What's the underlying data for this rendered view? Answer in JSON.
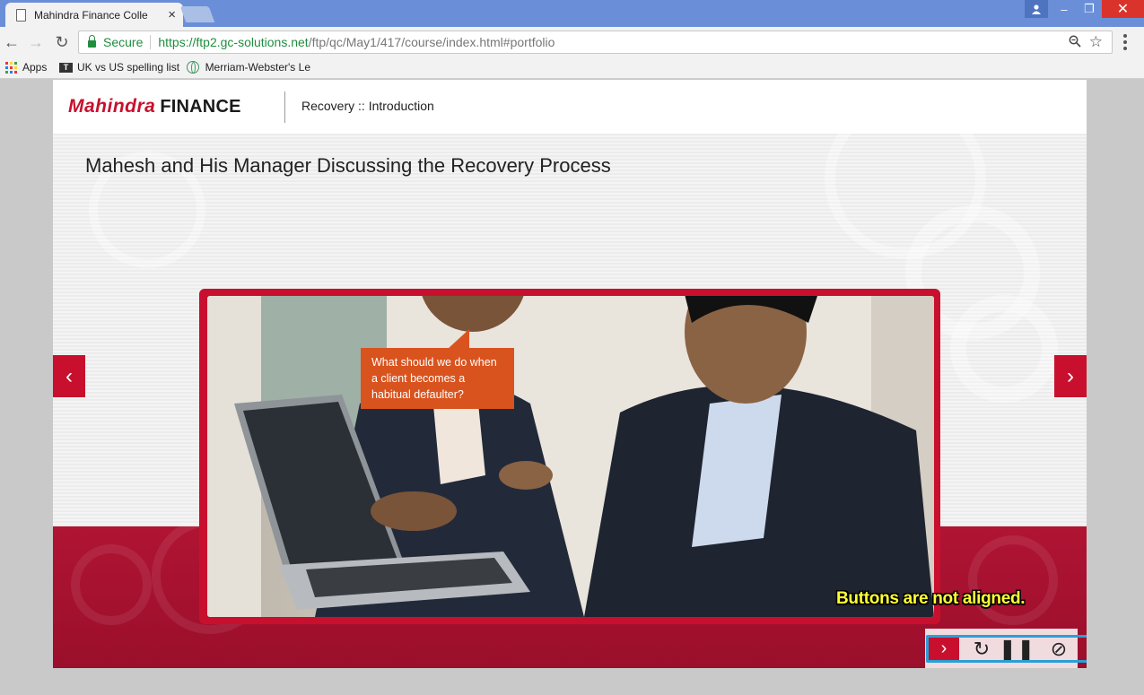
{
  "browser": {
    "tab_title": "Mahindra Finance Colle",
    "tab_close": "×",
    "window_controls": {
      "minimize": "–",
      "maximize": "❐",
      "close": "✕"
    },
    "nav": {
      "back": "←",
      "forward": "→",
      "reload": "↻"
    },
    "address": {
      "secure_label": "Secure",
      "url_host": "https://ftp2.gc-solutions.net",
      "url_path": "/ftp/qc/May1/417/course/index.html#portfolio"
    },
    "bookmarks": [
      {
        "label": "Apps",
        "icon": "apps-grid-icon"
      },
      {
        "label": "UK vs US spelling list",
        "icon": "site-icon"
      },
      {
        "label": "Merriam-Webster's Le",
        "icon": "globe-icon"
      }
    ]
  },
  "course": {
    "logo_brand": "Mahindra",
    "logo_finance": "FINANCE",
    "breadcrumb": "Recovery :: Introduction",
    "slide_title": "Mahesh and His Manager Discussing the Recovery Process",
    "speech_bubble": "What should we do when a client becomes a habitual defaulter?",
    "prev_arrow": "‹",
    "next_arrow": "›",
    "annotation": "Buttons are not aligned.",
    "controls": {
      "next": "›",
      "replay": "↻",
      "pause": "❚❚",
      "stop": "⊘"
    }
  },
  "colors": {
    "brand_red": "#c8102e",
    "bubble_orange": "#d9531e",
    "highlight_blue": "#2a9fd8",
    "annotation_yellow": "#ffff33",
    "chrome_blue": "#6a8fd8"
  }
}
